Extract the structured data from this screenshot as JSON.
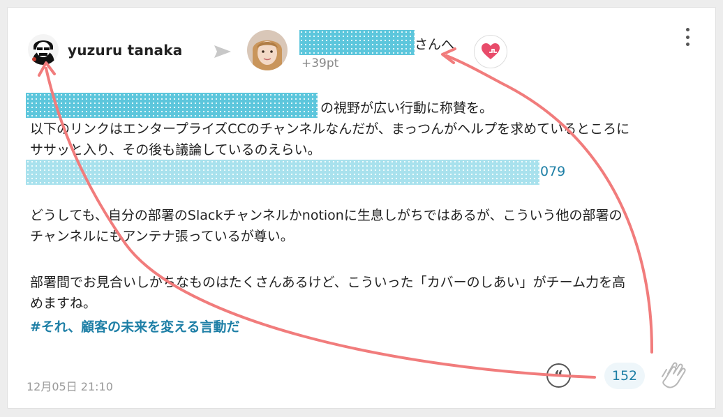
{
  "post": {
    "sender": {
      "name": "yuzuru tanaka"
    },
    "recipient": {
      "suffix": "さんへ",
      "points": "+39pt"
    },
    "body": {
      "line1_suffix": "の視野が広い行動に称賛を。",
      "line2": "以下のリンクはエンタープライズCCのチャンネルなんだが、まっつんがヘルプを求めているところに",
      "line3": "ササッと入り、その後も議論しているのえらい。",
      "link_suffix": "079",
      "line5": "どうしても、自分の部署のSlackチャンネルかnotionに生息しがちではあるが、こういう他の部署の",
      "line6": "チャンネルにもアンテナ張っているが尊い。",
      "line8": "部署間でお見合いしがちなものはたくさんあるけど、こういった「カバーのしあい」がチーム力を高",
      "line9": "めますね。"
    },
    "hashtag": "#それ、顧客の未来を変える言動だ",
    "timestamp": "12月05日 21:10",
    "clap_count": "152"
  },
  "icons": {
    "send": "send-arrow-icon",
    "heart": "heart-icon",
    "more": "more-vertical-icon",
    "quote": "quote-icon",
    "clap": "clap-hands-icon"
  },
  "colors": {
    "accent": "#1e7fa6",
    "heart": "#e84b6a",
    "annotation_arrow": "#f17c7c",
    "redaction": "#5cc6dc"
  }
}
